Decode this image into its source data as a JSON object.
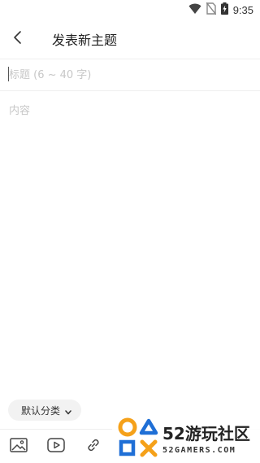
{
  "status_bar": {
    "time": "9:35",
    "icons": [
      "wifi-icon",
      "no-sim-icon",
      "battery-charging-icon"
    ]
  },
  "header": {
    "back_icon": "chevron-left-icon",
    "title": "发表新主题"
  },
  "title_field": {
    "placeholder": "标题 (6 ~ 40 字)",
    "value": ""
  },
  "content_field": {
    "placeholder": "内容",
    "value": ""
  },
  "category": {
    "label": "默认分类",
    "icon": "chevron-down-icon"
  },
  "toolbar": {
    "items": [
      "image-icon",
      "video-icon",
      "link-icon"
    ]
  },
  "watermark": {
    "title": "52游玩社区",
    "subtitle": "52GAMERS.COM",
    "colors": {
      "orange": "#f5a11a",
      "blue": "#1f6fd6"
    }
  }
}
